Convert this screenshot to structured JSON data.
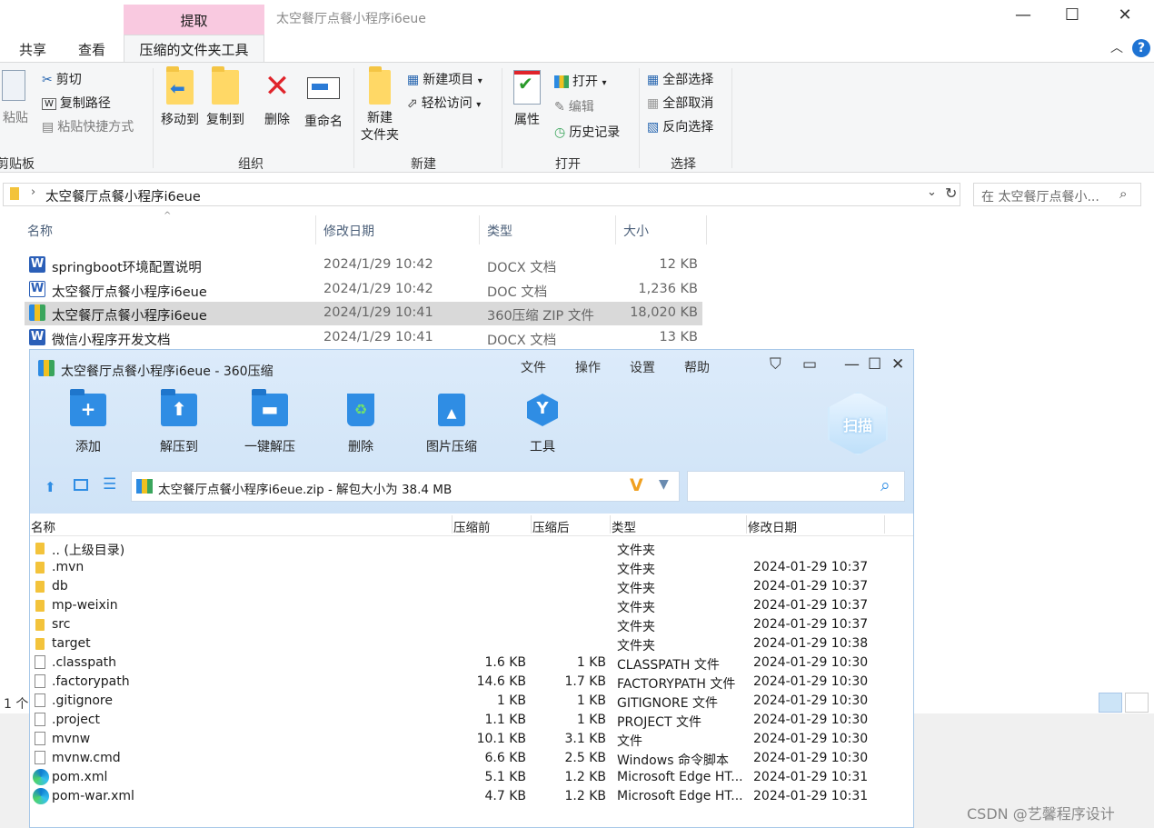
{
  "explorer": {
    "context_tab": "提取",
    "title": "太空餐厅点餐小程序i6eue",
    "tabs": [
      "共享",
      "查看"
    ],
    "active_tab": "压缩的文件夹工具",
    "ribbon": {
      "clipboard": {
        "paste": "粘贴",
        "cut": "剪切",
        "copy_path": "复制路径",
        "paste_shortcut": "粘贴快捷方式",
        "label": "剪贴板"
      },
      "organize": {
        "move_to": "移动到",
        "copy_to": "复制到",
        "delete": "删除",
        "rename": "重命名",
        "label": "组织"
      },
      "new": {
        "new_folder_l1": "新建",
        "new_folder_l2": "文件夹",
        "new_item": "新建项目",
        "easy_access": "轻松访问",
        "label": "新建"
      },
      "open": {
        "properties": "属性",
        "open": "打开",
        "edit": "编辑",
        "history": "历史记录",
        "label": "打开"
      },
      "select": {
        "select_all": "全部选择",
        "select_none": "全部取消",
        "invert": "反向选择",
        "label": "选择"
      }
    },
    "address": "太空餐厅点餐小程序i6eue",
    "search_placeholder": "在 太空餐厅点餐小...",
    "columns": {
      "name": "名称",
      "date": "修改日期",
      "type": "类型",
      "size": "大小"
    },
    "files": [
      {
        "name": "springboot环境配置说明",
        "date": "2024/1/29 10:42",
        "type": "DOCX 文档",
        "size": "12 KB"
      },
      {
        "name": "太空餐厅点餐小程序i6eue",
        "date": "2024/1/29 10:42",
        "type": "DOC 文档",
        "size": "1,236 KB"
      },
      {
        "name": "太空餐厅点餐小程序i6eue",
        "date": "2024/1/29 10:41",
        "type": "360压缩 ZIP 文件",
        "size": "18,020 KB"
      },
      {
        "name": "微信小程序开发文档",
        "date": "2024/1/29 10:41",
        "type": "DOCX 文档",
        "size": "13 KB"
      }
    ],
    "status": "1 个"
  },
  "z360": {
    "title": "太空餐厅点餐小程序i6eue - 360压缩",
    "menu": [
      "文件",
      "操作",
      "设置",
      "帮助"
    ],
    "tools": [
      "添加",
      "解压到",
      "一键解压",
      "删除",
      "图片压缩",
      "工具"
    ],
    "scan": "扫描",
    "path": "太空餐厅点餐小程序i6eue.zip - 解包大小为 38.4 MB",
    "columns": {
      "name": "名称",
      "before": "压缩前",
      "after": "压缩后",
      "type": "类型",
      "date": "修改日期"
    },
    "rows": [
      {
        "name": ".. (上级目录)",
        "before": "",
        "after": "",
        "type": "文件夹",
        "date": "",
        "icon": "folder"
      },
      {
        "name": ".mvn",
        "before": "",
        "after": "",
        "type": "文件夹",
        "date": "2024-01-29 10:37",
        "icon": "folder"
      },
      {
        "name": "db",
        "before": "",
        "after": "",
        "type": "文件夹",
        "date": "2024-01-29 10:37",
        "icon": "folder"
      },
      {
        "name": "mp-weixin",
        "before": "",
        "after": "",
        "type": "文件夹",
        "date": "2024-01-29 10:37",
        "icon": "folder"
      },
      {
        "name": "src",
        "before": "",
        "after": "",
        "type": "文件夹",
        "date": "2024-01-29 10:37",
        "icon": "folder"
      },
      {
        "name": "target",
        "before": "",
        "after": "",
        "type": "文件夹",
        "date": "2024-01-29 10:38",
        "icon": "folder"
      },
      {
        "name": ".classpath",
        "before": "1.6 KB",
        "after": "1 KB",
        "type": "CLASSPATH 文件",
        "date": "2024-01-29 10:30",
        "icon": "file"
      },
      {
        "name": ".factorypath",
        "before": "14.6 KB",
        "after": "1.7 KB",
        "type": "FACTORYPATH 文件",
        "date": "2024-01-29 10:30",
        "icon": "file"
      },
      {
        "name": ".gitignore",
        "before": "1 KB",
        "after": "1 KB",
        "type": "GITIGNORE 文件",
        "date": "2024-01-29 10:30",
        "icon": "file"
      },
      {
        "name": ".project",
        "before": "1.1 KB",
        "after": "1 KB",
        "type": "PROJECT 文件",
        "date": "2024-01-29 10:30",
        "icon": "file"
      },
      {
        "name": "mvnw",
        "before": "10.1 KB",
        "after": "3.1 KB",
        "type": "文件",
        "date": "2024-01-29 10:30",
        "icon": "file"
      },
      {
        "name": "mvnw.cmd",
        "before": "6.6 KB",
        "after": "2.5 KB",
        "type": "Windows 命令脚本",
        "date": "2024-01-29 10:30",
        "icon": "file"
      },
      {
        "name": "pom.xml",
        "before": "5.1 KB",
        "after": "1.2 KB",
        "type": "Microsoft Edge HT...",
        "date": "2024-01-29 10:31",
        "icon": "edge"
      },
      {
        "name": "pom-war.xml",
        "before": "4.7 KB",
        "after": "1.2 KB",
        "type": "Microsoft Edge HT...",
        "date": "2024-01-29 10:31",
        "icon": "edge"
      }
    ]
  },
  "watermark": "CSDN @艺馨程序设计"
}
